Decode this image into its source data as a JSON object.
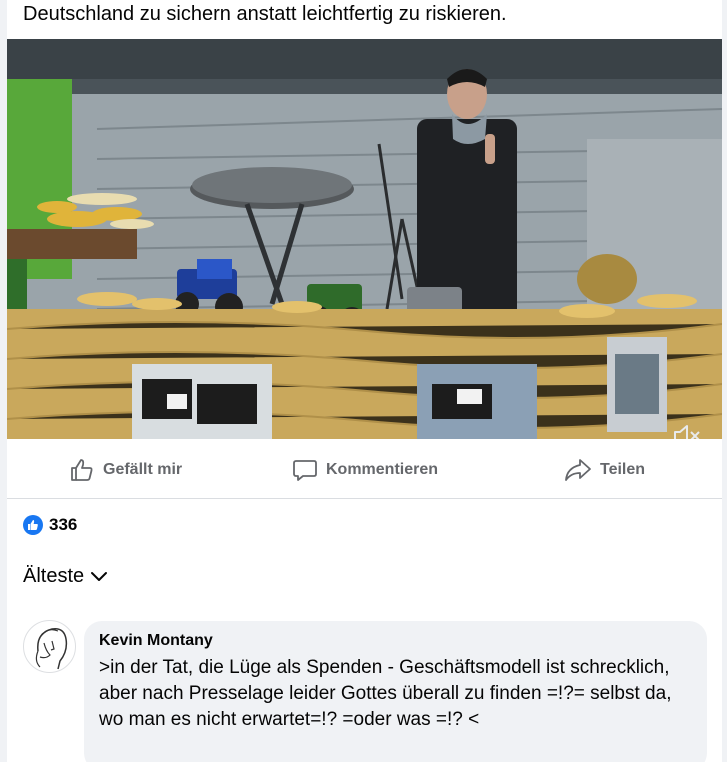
{
  "post": {
    "text_line": "Deutschland zu sichern anstatt leichtfertig zu riskieren."
  },
  "video": {
    "mute_icon": "speaker-mute-icon"
  },
  "actions": {
    "like_label": "Gefällt mir",
    "comment_label": "Kommentieren",
    "share_label": "Teilen"
  },
  "reactions": {
    "count": "336",
    "icon": "thumbs-up-icon"
  },
  "sort": {
    "label": "Älteste",
    "icon": "chevron-down-icon"
  },
  "comment": {
    "author": "Kevin Montany",
    "text": ">in der Tat, die Lüge als Spenden - Geschäftsmodell ist schrecklich, aber nach Presselage leider Gottes überall zu finden =!?= selbst da, wo man es nicht erwartet=!? =oder was =!? <"
  },
  "colors": {
    "accent": "#1877f2",
    "secondary_text": "#65676b",
    "bubble_bg": "#f0f2f5"
  }
}
